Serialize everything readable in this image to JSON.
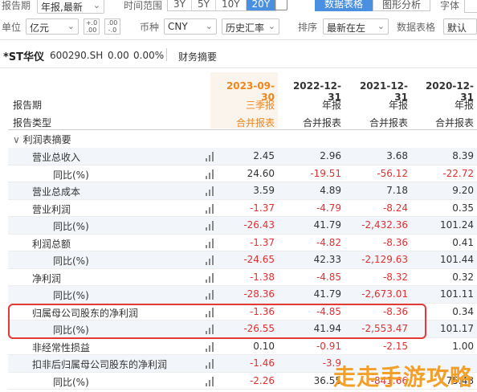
{
  "toolbar1": {
    "period_label": "报告期",
    "period_value": "年报,最新",
    "range_label": "时间范围",
    "range_options": [
      "3Y",
      "5Y",
      "10Y",
      "20Y"
    ],
    "range_active": "20Y",
    "table_btn": "数据表格",
    "chart_btn": "图形分析",
    "font_label": "字体"
  },
  "toolbar2": {
    "unit_label": "单位",
    "unit_value": "亿元",
    "currency_label": "币种",
    "currency_value": "CNY",
    "rate_value": "历史汇率",
    "sort_label": "排序",
    "sort_value": "最新在左",
    "grid_label": "数据表格",
    "grid_value": "默认"
  },
  "stock": {
    "name": "*ST华仪",
    "code": "600290.SH",
    "price": "0.00",
    "change": "0.00%",
    "section": "财务摘要"
  },
  "table": {
    "period_row_label": "报告期",
    "type_row_label": "报告类型",
    "columns": [
      {
        "date": "2023-09-30",
        "period": "三季报",
        "type": "合并报表",
        "accent": true
      },
      {
        "date": "2022-12-31",
        "period": "年报",
        "type": "合并报表",
        "accent": false
      },
      {
        "date": "2021-12-31",
        "period": "年报",
        "type": "合并报表",
        "accent": false
      },
      {
        "date": "2020-12-31",
        "period": "年报",
        "type": "合并报表",
        "accent": false
      }
    ],
    "group_label": "利润表摘要",
    "rows": [
      {
        "name": "营业总收入",
        "sub": false,
        "vals": [
          "2.45",
          "2.96",
          "3.68",
          "8.39"
        ]
      },
      {
        "name": "同比(%)",
        "sub": true,
        "vals": [
          "24.60",
          "-19.51",
          "-56.12",
          "-22.72"
        ]
      },
      {
        "name": "营业总成本",
        "sub": false,
        "vals": [
          "3.59",
          "4.89",
          "7.18",
          "9.20"
        ]
      },
      {
        "name": "营业利润",
        "sub": false,
        "vals": [
          "-1.37",
          "-4.79",
          "-8.24",
          "0.35"
        ]
      },
      {
        "name": "同比(%)",
        "sub": true,
        "vals": [
          "-26.43",
          "41.79",
          "-2,432.36",
          "101.24"
        ]
      },
      {
        "name": "利润总额",
        "sub": false,
        "vals": [
          "-1.37",
          "-4.82",
          "-8.36",
          "0.41"
        ]
      },
      {
        "name": "同比(%)",
        "sub": true,
        "vals": [
          "-24.65",
          "42.33",
          "-2,129.63",
          "101.44"
        ]
      },
      {
        "name": "净利润",
        "sub": false,
        "vals": [
          "-1.38",
          "-4.85",
          "-8.32",
          "0.32"
        ]
      },
      {
        "name": "同比(%)",
        "sub": true,
        "vals": [
          "-28.36",
          "41.79",
          "-2,673.01",
          "101.11"
        ]
      },
      {
        "name": "归属母公司股东的净利润",
        "sub": false,
        "vals": [
          "-1.36",
          "-4.85",
          "-8.36",
          "0.34"
        ]
      },
      {
        "name": "同比(%)",
        "sub": true,
        "vals": [
          "-26.55",
          "41.94",
          "-2,553.47",
          "101.17"
        ]
      },
      {
        "name": "非经常性损益",
        "sub": false,
        "vals": [
          "0.10",
          "-0.91",
          "-2.15",
          "1.00"
        ]
      },
      {
        "name": "扣非后归属母公司股东的净利润",
        "sub": false,
        "vals": [
          "-1.46",
          "-3.9",
          "",
          ""
        ]
      },
      {
        "name": "同比(%)",
        "sub": true,
        "vals": [
          "-2.26",
          "36.55",
          "-841.66",
          "75.48"
        ]
      }
    ]
  },
  "watermark": "走走手游攻略",
  "colors": {
    "accent": "#f0851a",
    "negative": "#e03030",
    "active_blue": "#4a90e2",
    "highlight_box": "#e53935"
  }
}
